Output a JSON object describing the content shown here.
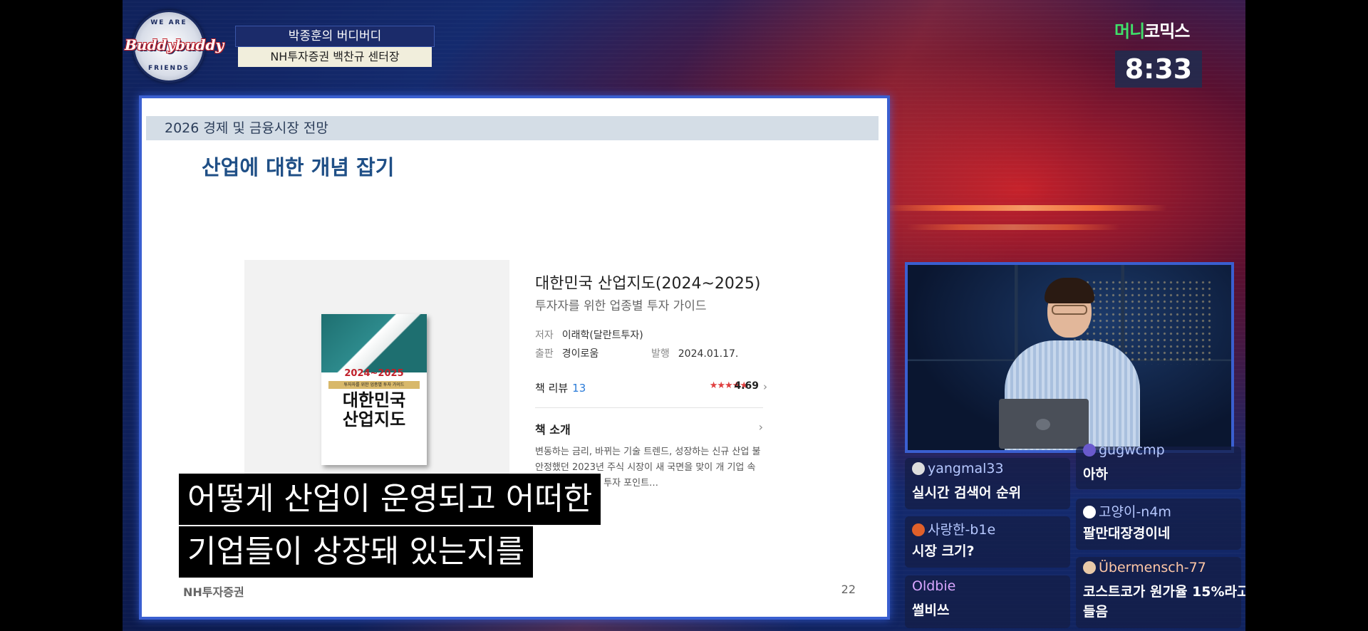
{
  "show": {
    "logo_top": "WE ARE",
    "logo_script": "Buddybuddy",
    "logo_bottom": "FRIENDS",
    "title": "박종훈의 버디버디",
    "guest": "NH투자증권 백찬규 센터장"
  },
  "channel": {
    "logo_part1": "머니",
    "logo_part2": "코믹스",
    "clock": "8:33"
  },
  "slide": {
    "header": "2026 경제 및 금융시장 전망",
    "title": "산업에 대한 개념 잡기",
    "book": {
      "cover_year": "2024~2025",
      "cover_sub": "투자자를 위한 업종별 투자 가이드",
      "cover_title_1": "대한민국",
      "cover_title_2": "산업지도",
      "title": "대한민국 산업지도(2024~2025)",
      "subtitle": "투자자를 위한 업종별 투자 가이드",
      "author_label": "저자",
      "author": "이래학(달란트투자)",
      "publisher_label": "출판",
      "publisher": "경이로움",
      "date_label": "발행",
      "date": "2024.01.17.",
      "review_label": "책 리뷰",
      "review_count": "13",
      "stars": "★★★★★",
      "rating": "4.69",
      "rating_chevron": "›",
      "intro_label": "책 소개",
      "intro_chevron": "›",
      "intro_text": "변동하는 금리, 바뀌는 기술 트렌드, 성장하는 신규 산업 불안정했던 2023년 주식 시장이 새 국면을 맞이 개 기업 속에서 떠오 전체의 투자 포인트…"
    },
    "footer_logo": "NH투자증권",
    "page": "22"
  },
  "captions": {
    "line1": "어떻게 산업이 운영되고 어떠한",
    "line2": "기업들이 상장돼 있는지를"
  },
  "chat": [
    {
      "user": "yangmal33",
      "message": "실시간 검색어 순위",
      "avatar_color": "#dddddd"
    },
    {
      "user": "gugwcmp",
      "message": "아하",
      "avatar_color": "#6a5acd"
    },
    {
      "user": "사랑한-b1e",
      "message": "시장 크기?",
      "avatar_color": "#e0602a"
    },
    {
      "user": "고양이-n4m",
      "message": "팔만대장경이네",
      "avatar_color": "#ffffff"
    },
    {
      "user": "Oldbie",
      "message": "썰비쓰",
      "avatar_color": ""
    },
    {
      "user": "Übermensch-77",
      "message": "코스트코가 원가율 15%라고",
      "message2": "들음",
      "avatar_color": "#e8c9a8"
    }
  ]
}
